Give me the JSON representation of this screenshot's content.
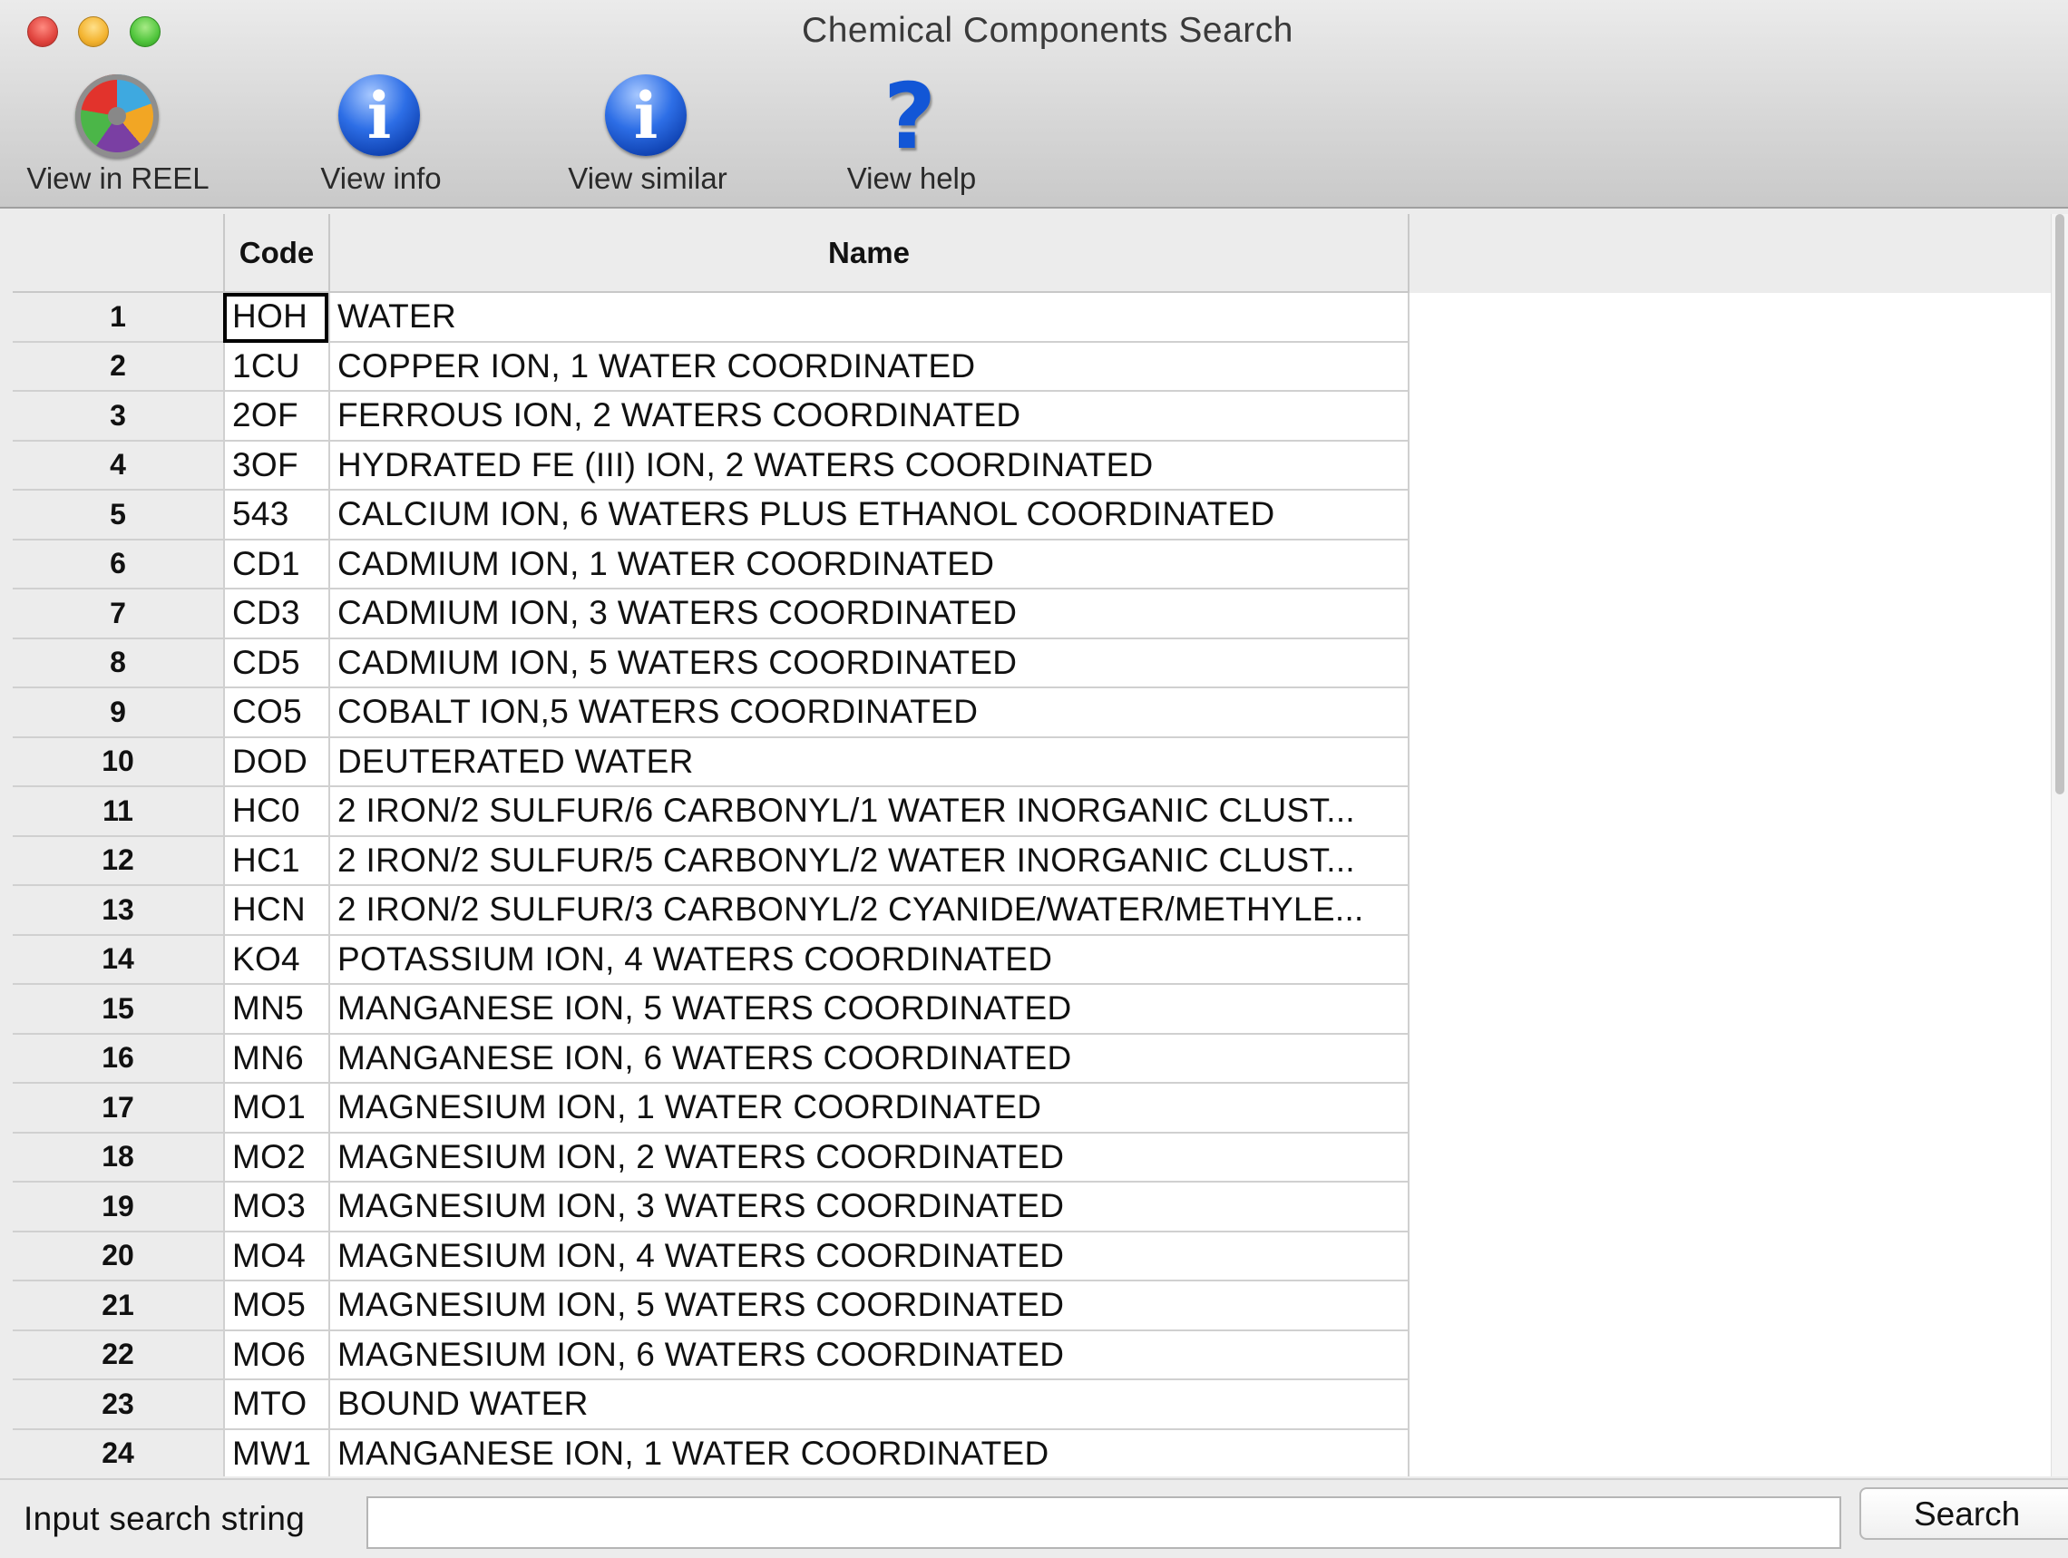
{
  "window": {
    "title": "Chemical Components Search"
  },
  "toolbar": {
    "view_in_reel": "View in REEL",
    "view_info": "View info",
    "view_similar": "View similar",
    "view_help": "View help",
    "info_glyph": "i",
    "help_glyph": "?"
  },
  "table": {
    "columns": {
      "code": "Code",
      "name": "Name"
    },
    "selected_row": 1,
    "rows": [
      {
        "num": "1",
        "code": "HOH",
        "name": "WATER"
      },
      {
        "num": "2",
        "code": "1CU",
        "name": "COPPER ION, 1 WATER COORDINATED"
      },
      {
        "num": "3",
        "code": "2OF",
        "name": "FERROUS ION, 2 WATERS COORDINATED"
      },
      {
        "num": "4",
        "code": "3OF",
        "name": "HYDRATED FE (III) ION, 2 WATERS COORDINATED"
      },
      {
        "num": "5",
        "code": "543",
        "name": "CALCIUM ION, 6 WATERS PLUS ETHANOL COORDINATED"
      },
      {
        "num": "6",
        "code": "CD1",
        "name": "CADMIUM ION, 1 WATER COORDINATED"
      },
      {
        "num": "7",
        "code": "CD3",
        "name": "CADMIUM ION, 3 WATERS COORDINATED"
      },
      {
        "num": "8",
        "code": "CD5",
        "name": "CADMIUM ION, 5 WATERS COORDINATED"
      },
      {
        "num": "9",
        "code": "CO5",
        "name": "COBALT ION,5 WATERS COORDINATED"
      },
      {
        "num": "10",
        "code": "DOD",
        "name": "DEUTERATED WATER"
      },
      {
        "num": "11",
        "code": "HC0",
        "name": "2 IRON/2 SULFUR/6 CARBONYL/1 WATER INORGANIC CLUST..."
      },
      {
        "num": "12",
        "code": "HC1",
        "name": "2 IRON/2 SULFUR/5 CARBONYL/2 WATER INORGANIC CLUST..."
      },
      {
        "num": "13",
        "code": "HCN",
        "name": "2 IRON/2 SULFUR/3 CARBONYL/2 CYANIDE/WATER/METHYLE..."
      },
      {
        "num": "14",
        "code": "KO4",
        "name": "POTASSIUM ION, 4 WATERS COORDINATED"
      },
      {
        "num": "15",
        "code": "MN5",
        "name": "MANGANESE ION, 5 WATERS COORDINATED"
      },
      {
        "num": "16",
        "code": "MN6",
        "name": "MANGANESE ION, 6 WATERS COORDINATED"
      },
      {
        "num": "17",
        "code": "MO1",
        "name": "MAGNESIUM ION, 1 WATER COORDINATED"
      },
      {
        "num": "18",
        "code": "MO2",
        "name": "MAGNESIUM ION, 2 WATERS COORDINATED"
      },
      {
        "num": "19",
        "code": "MO3",
        "name": "MAGNESIUM ION, 3 WATERS COORDINATED"
      },
      {
        "num": "20",
        "code": "MO4",
        "name": "MAGNESIUM ION, 4 WATERS COORDINATED"
      },
      {
        "num": "21",
        "code": "MO5",
        "name": "MAGNESIUM ION, 5 WATERS COORDINATED"
      },
      {
        "num": "22",
        "code": "MO6",
        "name": "MAGNESIUM ION, 6 WATERS COORDINATED"
      },
      {
        "num": "23",
        "code": "MTO",
        "name": "BOUND WATER"
      },
      {
        "num": "24",
        "code": "MW1",
        "name": "MANGANESE ION, 1 WATER COORDINATED"
      }
    ]
  },
  "search": {
    "label": "Input search string",
    "value": "",
    "button_label": "Search"
  }
}
